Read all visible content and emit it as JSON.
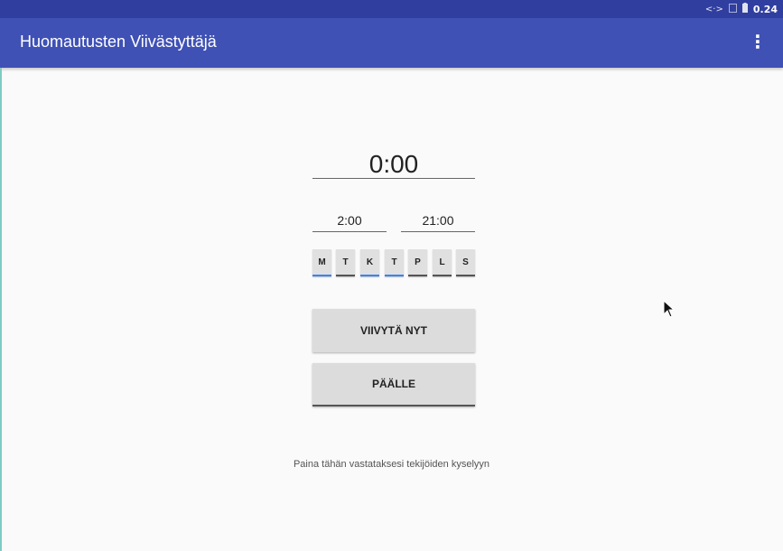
{
  "status_bar": {
    "icons": [
      "code-arrows-icon",
      "no-sim-icon",
      "battery-icon"
    ],
    "code_glyph": "<·>",
    "time": "0.24"
  },
  "app_bar": {
    "title": "Huomautusten Viivästyttäjä",
    "menu_icon": "more-vert-icon"
  },
  "delay": {
    "value": "0:00"
  },
  "schedule": {
    "start": "2:00",
    "end": "21:00"
  },
  "days": [
    {
      "label": "M",
      "active": true
    },
    {
      "label": "T",
      "active": false
    },
    {
      "label": "K",
      "active": true
    },
    {
      "label": "T",
      "active": true
    },
    {
      "label": "P",
      "active": false
    },
    {
      "label": "L",
      "active": false
    },
    {
      "label": "S",
      "active": false
    }
  ],
  "buttons": {
    "snooze_now": "VIIVYTÄ NYT",
    "toggle": "PÄÄLLE"
  },
  "survey_text": "Paina tähän vastataksesi tekijöiden kyselyyn",
  "colors": {
    "status_bar": "#303f9f",
    "app_bar": "#3f51b5",
    "day_active_indicator": "#3b82f6"
  }
}
